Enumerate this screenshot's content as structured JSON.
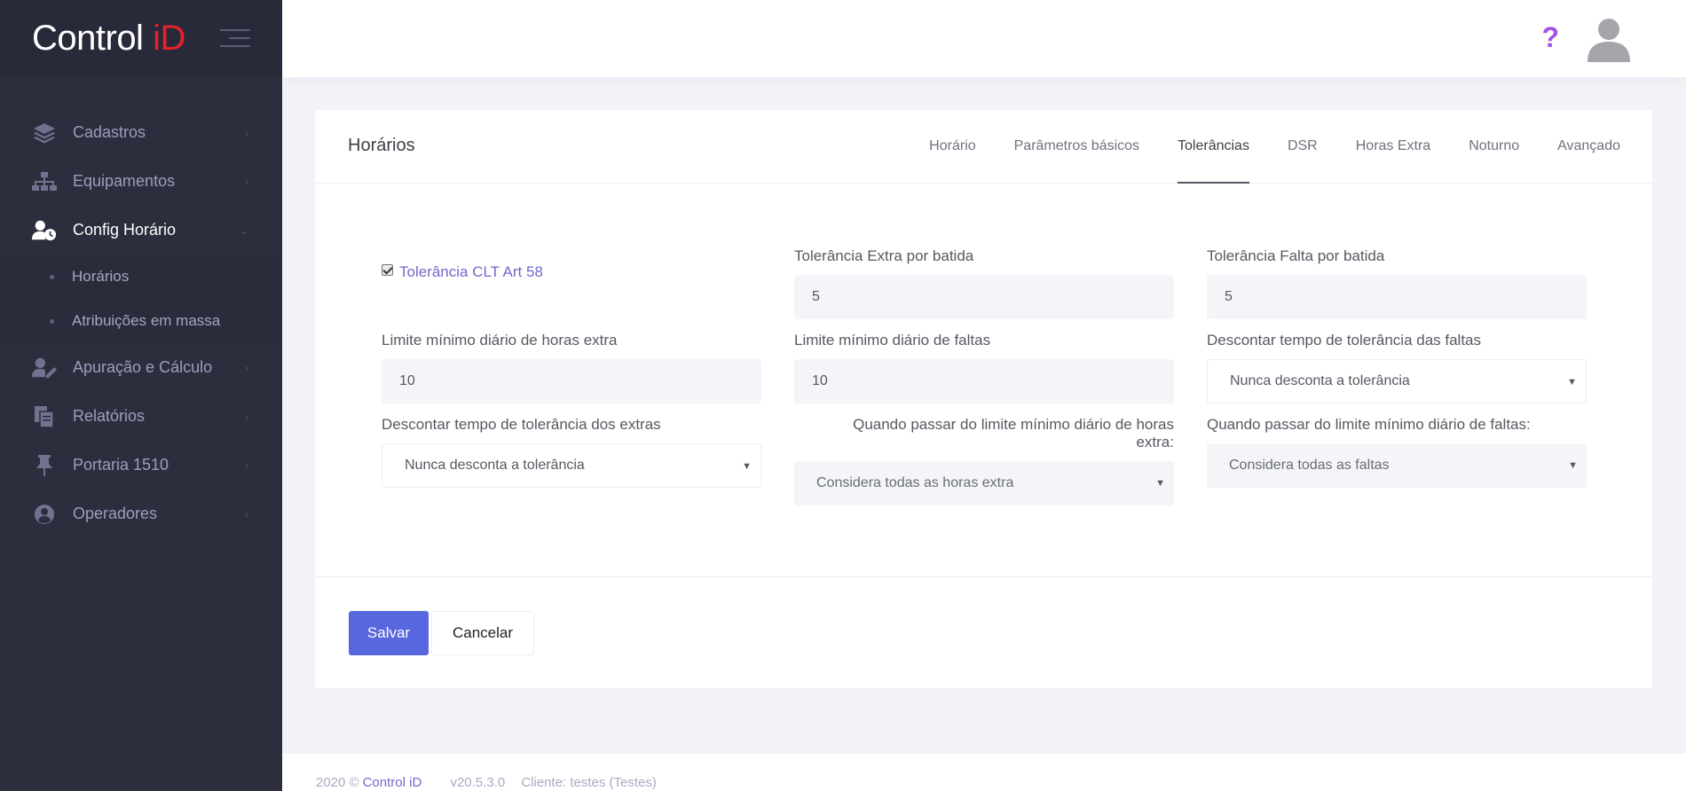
{
  "brand": {
    "logo_main": "Control ",
    "logo_accent": "iD"
  },
  "sidebar": {
    "items": [
      {
        "label": "Cadastros",
        "icon": "layers-icon"
      },
      {
        "label": "Equipamentos",
        "icon": "sitemap-icon"
      },
      {
        "label": "Config Horário",
        "icon": "user-clock-icon",
        "expanded": true
      },
      {
        "label": "Apuração e Cálculo",
        "icon": "user-edit-icon"
      },
      {
        "label": "Relatórios",
        "icon": "files-icon"
      },
      {
        "label": "Portaria 1510",
        "icon": "pin-icon"
      },
      {
        "label": "Operadores",
        "icon": "user-circle-icon"
      }
    ],
    "subitems": [
      {
        "label": "Horários"
      },
      {
        "label": "Atribuições em massa"
      }
    ]
  },
  "header": {
    "help": "?"
  },
  "card": {
    "title": "Horários",
    "tabs": [
      "Horário",
      "Parâmetros básicos",
      "Tolerâncias",
      "DSR",
      "Horas Extra",
      "Noturno",
      "Avançado"
    ],
    "active_tab": "Tolerâncias"
  },
  "form": {
    "clt_checkbox_label": "Tolerância CLT Art 58",
    "clt_checked": true,
    "extra_por_batida": {
      "label": "Tolerância Extra por batida",
      "value": "5"
    },
    "falta_por_batida": {
      "label": "Tolerância Falta por batida",
      "value": "5"
    },
    "limite_horas_extra": {
      "label": "Limite mínimo diário de horas extra",
      "value": "10"
    },
    "limite_faltas": {
      "label": "Limite mínimo diário de faltas",
      "value": "10"
    },
    "descontar_faltas": {
      "label": "Descontar tempo de tolerância das faltas",
      "value": "Nunca desconta a tolerância"
    },
    "descontar_extras": {
      "label": "Descontar tempo de tolerância dos extras",
      "value": "Nunca desconta a tolerância"
    },
    "quando_horas_extra": {
      "label_line1": "Quando passar do limite mínimo diário de horas",
      "label_line2": "extra:",
      "value": "Considera todas as horas extra"
    },
    "quando_faltas": {
      "label": "Quando passar do limite mínimo diário de faltas:",
      "value": "Considera todas as faltas"
    }
  },
  "actions": {
    "save": "Salvar",
    "cancel": "Cancelar"
  },
  "footer": {
    "copyright": "2020 ©",
    "brand": "Control iD",
    "version": "v20.5.3.0",
    "client": "Cliente: testes (Testes)"
  },
  "colors": {
    "sidebar_bg": "#2c2e3e",
    "accent": "#5867dd",
    "link": "#716aca",
    "logo_red": "#e8202a"
  }
}
